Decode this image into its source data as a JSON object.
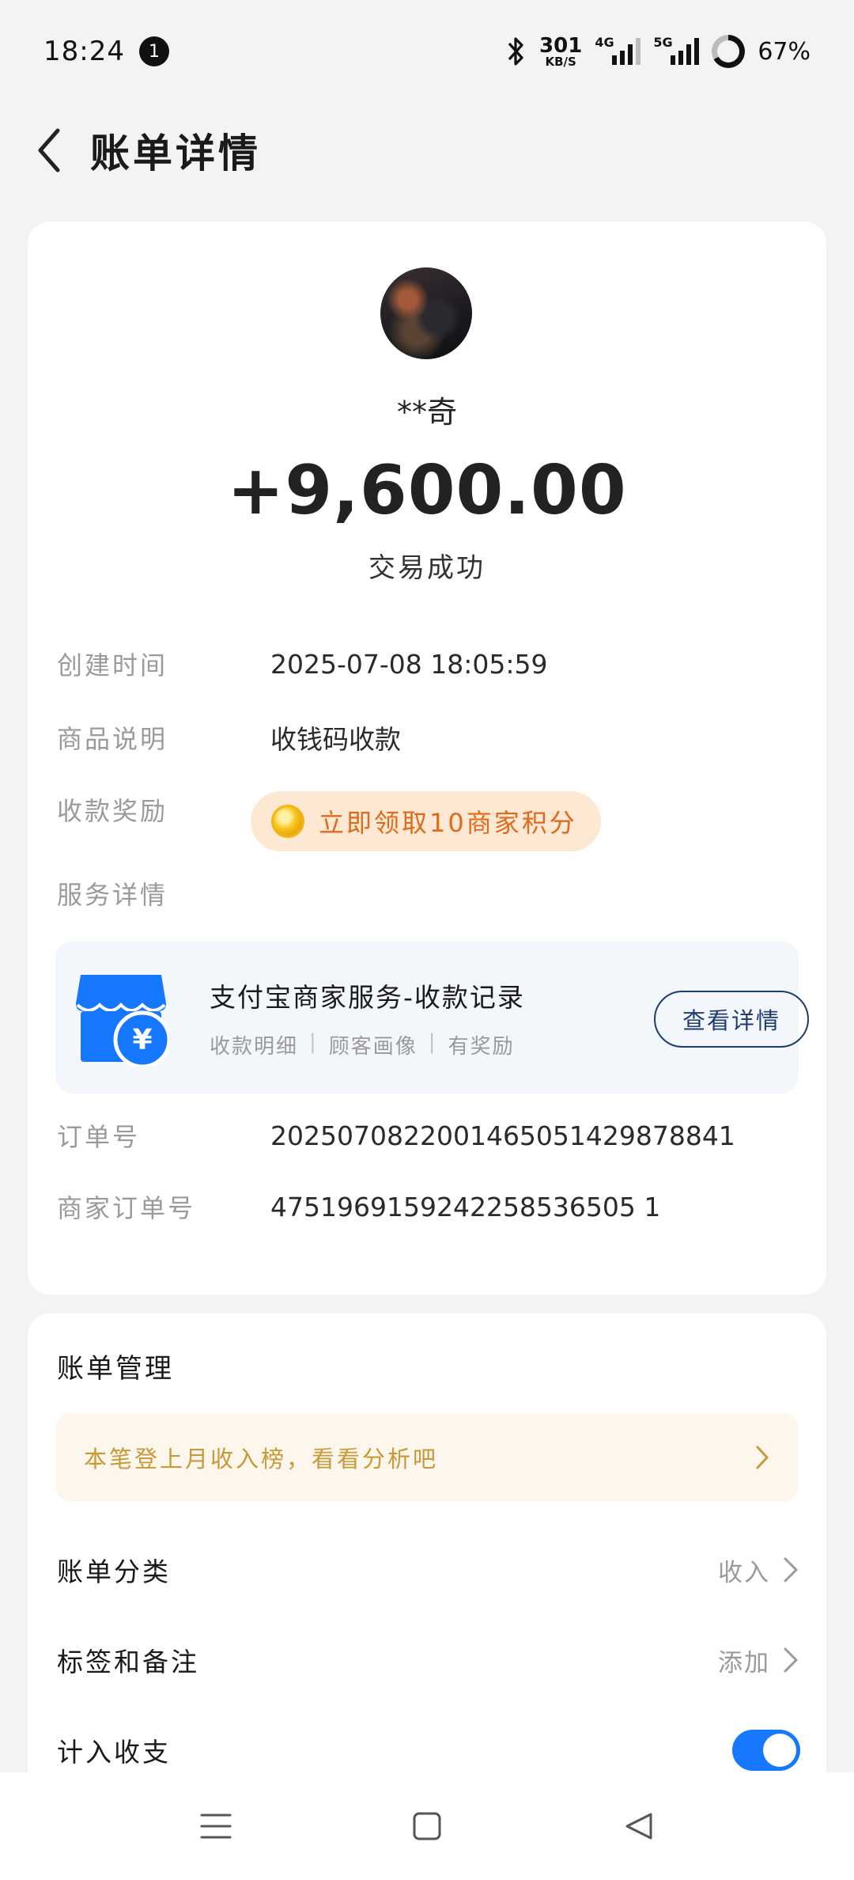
{
  "status_bar": {
    "time": "18:24",
    "notification_count": "1",
    "net_speed": "301",
    "net_speed_unit": "KB/S",
    "sig1_label": "4G",
    "sig2_label": "5G",
    "battery": "67%"
  },
  "header": {
    "title": "账单详情"
  },
  "transaction": {
    "name": "**奇",
    "amount": "+9,600.00",
    "status": "交易成功"
  },
  "details": {
    "created_label": "创建时间",
    "created_value": "2025-07-08 18:05:59",
    "desc_label": "商品说明",
    "desc_value": "收钱码收款",
    "reward_label": "收款奖励",
    "reward_value": "立即领取10商家积分",
    "service_label": "服务详情",
    "order_label": "订单号",
    "order_value": "2025070822001465051429878841",
    "merchant_order_label": "商家订单号",
    "merchant_order_value": "4751969159242258536505 1"
  },
  "service": {
    "title": "支付宝商家服务-收款记录",
    "tags": [
      "收款明细",
      "顾客画像",
      "有奖励"
    ],
    "button": "查看详情"
  },
  "manage": {
    "title": "账单管理",
    "tip": "本笔登上月收入榜，看看分析吧",
    "category_label": "账单分类",
    "category_value": "收入",
    "tag_label": "标签和备注",
    "tag_value": "添加",
    "count_label": "计入收支",
    "count_enabled": true
  },
  "colors": {
    "accent": "#1677ff",
    "reward_text": "#e06a1b",
    "tip_text": "#c79a36",
    "button_border": "#1e3c72"
  }
}
